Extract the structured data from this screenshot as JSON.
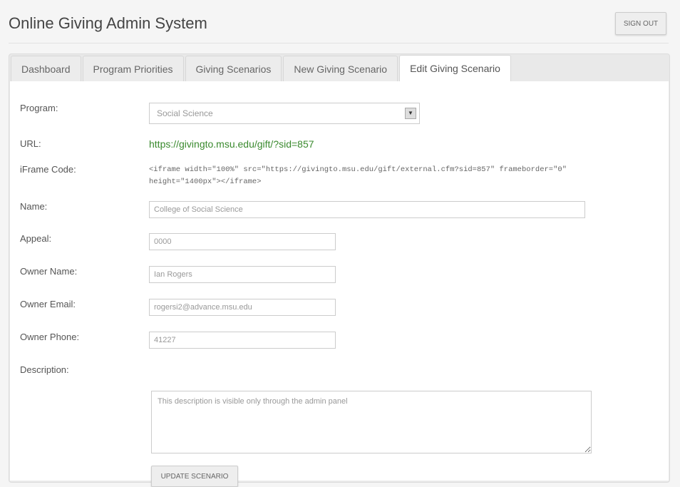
{
  "app": {
    "title": "Online Giving Admin System",
    "sign_out_label": "SIGN OUT"
  },
  "tabs": [
    {
      "label": "Dashboard"
    },
    {
      "label": "Program Priorities"
    },
    {
      "label": "Giving Scenarios"
    },
    {
      "label": "New Giving Scenario"
    },
    {
      "label": "Edit Giving Scenario",
      "active": true
    }
  ],
  "form": {
    "program": {
      "label": "Program:",
      "value": "Social Science"
    },
    "url": {
      "label": "URL:",
      "value": "https://givingto.msu.edu/gift/?sid=857"
    },
    "iframe_code": {
      "label": "iFrame Code:",
      "value": "<iframe width=\"100%\" src=\"https://givingto.msu.edu/gift/external.cfm?sid=857\" frameborder=\"0\" height=\"1400px\"></iframe>"
    },
    "name": {
      "label": "Name:",
      "value": "College of Social Science"
    },
    "appeal": {
      "label": "Appeal:",
      "value": "0000"
    },
    "owner_name": {
      "label": "Owner Name:",
      "value": "Ian Rogers"
    },
    "owner_email": {
      "label": "Owner Email:",
      "value": "rogersi2@advance.msu.edu"
    },
    "owner_phone": {
      "label": "Owner Phone:",
      "value": "41227"
    },
    "description": {
      "label": "Description:",
      "value": "This description is visible only through the admin panel"
    },
    "update_label": "UPDATE SCENARIO"
  },
  "colors": {
    "url_link": "#3a8a2e",
    "background": "#f5f5f5"
  }
}
